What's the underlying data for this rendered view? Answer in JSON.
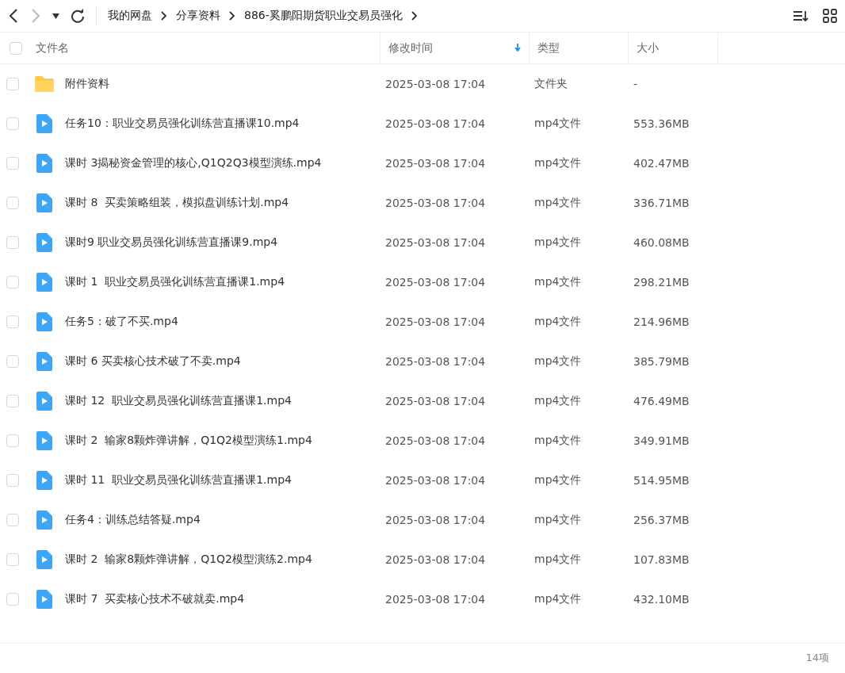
{
  "toolbar": {
    "breadcrumbs": [
      "我的网盘",
      "分享资料",
      "886-奚鹏阳期货职业交易员强化"
    ]
  },
  "table": {
    "select_all": {
      "checked": false
    },
    "columns": [
      {
        "label": "文件名",
        "sorted": false
      },
      {
        "label": "修改时间",
        "sorted": true
      },
      {
        "label": "类型",
        "sorted": false
      },
      {
        "label": "大小",
        "sorted": false
      }
    ],
    "rows": [
      {
        "kind": "folder",
        "checked": false,
        "name": "附件资料",
        "modified": "2025-03-08 17:04",
        "type": "文件夹",
        "size": "-"
      },
      {
        "kind": "video",
        "checked": false,
        "name": "任务10：职业交易员强化训练营直播课10.mp4",
        "modified": "2025-03-08 17:04",
        "type": "mp4文件",
        "size": "553.36MB"
      },
      {
        "kind": "video",
        "checked": false,
        "name": "课时 3揭秘资金管理的核心,Q1Q2Q3模型演练.mp4",
        "modified": "2025-03-08 17:04",
        "type": "mp4文件",
        "size": "402.47MB"
      },
      {
        "kind": "video",
        "checked": false,
        "name": "课时 8  买卖策略组装，模拟盘训练计划.mp4",
        "modified": "2025-03-08 17:04",
        "type": "mp4文件",
        "size": "336.71MB"
      },
      {
        "kind": "video",
        "checked": false,
        "name": "课时9 职业交易员强化训练营直播课9.mp4",
        "modified": "2025-03-08 17:04",
        "type": "mp4文件",
        "size": "460.08MB"
      },
      {
        "kind": "video",
        "checked": false,
        "name": "课时 1  职业交易员强化训练营直播课1.mp4",
        "modified": "2025-03-08 17:04",
        "type": "mp4文件",
        "size": "298.21MB"
      },
      {
        "kind": "video",
        "checked": false,
        "name": "任务5：破了不买.mp4",
        "modified": "2025-03-08 17:04",
        "type": "mp4文件",
        "size": "214.96MB"
      },
      {
        "kind": "video",
        "checked": false,
        "name": "课时 6 买卖核心技术破了不卖.mp4",
        "modified": "2025-03-08 17:04",
        "type": "mp4文件",
        "size": "385.79MB"
      },
      {
        "kind": "video",
        "checked": false,
        "name": "课时 12  职业交易员强化训练营直播课1.mp4",
        "modified": "2025-03-08 17:04",
        "type": "mp4文件",
        "size": "476.49MB"
      },
      {
        "kind": "video",
        "checked": false,
        "name": "课时 2  输家8颗炸弹讲解，Q1Q2模型演练1.mp4",
        "modified": "2025-03-08 17:04",
        "type": "mp4文件",
        "size": "349.91MB"
      },
      {
        "kind": "video",
        "checked": false,
        "name": "课时 11  职业交易员强化训练营直播课1.mp4",
        "modified": "2025-03-08 17:04",
        "type": "mp4文件",
        "size": "514.95MB"
      },
      {
        "kind": "video",
        "checked": false,
        "name": "任务4：训练总结答疑.mp4",
        "modified": "2025-03-08 17:04",
        "type": "mp4文件",
        "size": "256.37MB"
      },
      {
        "kind": "video",
        "checked": false,
        "name": "课时 2  输家8颗炸弹讲解，Q1Q2模型演练2.mp4",
        "modified": "2025-03-08 17:04",
        "type": "mp4文件",
        "size": "107.83MB"
      },
      {
        "kind": "video",
        "checked": false,
        "name": "课时 7  买卖核心技术不破就卖.mp4",
        "modified": "2025-03-08 17:04",
        "type": "mp4文件",
        "size": "432.10MB"
      }
    ]
  },
  "status_bar": {
    "count": "14项"
  }
}
